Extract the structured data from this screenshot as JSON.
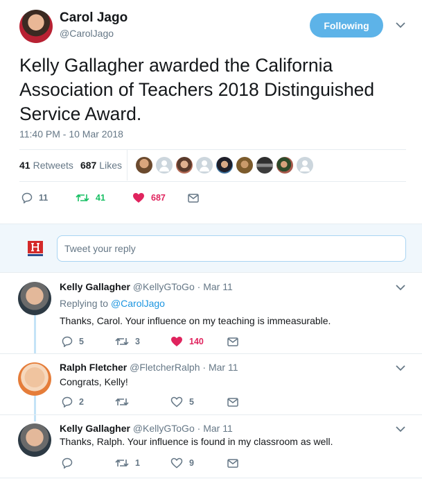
{
  "tweet": {
    "author_name": "Carol Jago",
    "author_handle": "@CarolJago",
    "follow_label": "Following",
    "text": "Kelly Gallagher awarded the California Association of Teachers 2018 Distinguished Service Award.",
    "timestamp": "11:40 PM - 10 Mar 2018",
    "retweets_count": "41",
    "retweets_label": "Retweets",
    "likes_count": "687",
    "likes_label": "Likes",
    "actions": {
      "replies": "11",
      "retweets": "41",
      "likes": "687"
    }
  },
  "reply_box": {
    "placeholder": "Tweet your reply"
  },
  "replies": [
    {
      "name": "Kelly Gallagher",
      "handle": "@KellyGToGo",
      "date": "· Mar 11",
      "replying_to_label": "Replying to",
      "replying_to_handle": "@CarolJago",
      "text": "Thanks, Carol. Your influence on my teaching is immeasurable.",
      "replies": "5",
      "retweets": "3",
      "likes": "140"
    },
    {
      "name": "Ralph Fletcher",
      "handle": "@FletcherRalph",
      "date": "· Mar 11",
      "text": "Congrats, Kelly!",
      "replies": "2",
      "retweets": "",
      "likes": "5"
    },
    {
      "name": "Kelly Gallagher",
      "handle": "@KellyGToGo",
      "date": "· Mar 11",
      "text": "Thanks, Ralph. Your influence is found in my classroom as well.",
      "replies": "",
      "retweets": "1",
      "likes": "9"
    }
  ],
  "colors": {
    "follow_button": "#5db3e8",
    "link": "#1b95e0",
    "retweet_active": "#17bf63",
    "like_active": "#e0245e",
    "muted_text": "#657786"
  },
  "icons": [
    "chevron-down-icon",
    "reply-icon",
    "retweet-icon",
    "heart-icon",
    "message-icon"
  ]
}
